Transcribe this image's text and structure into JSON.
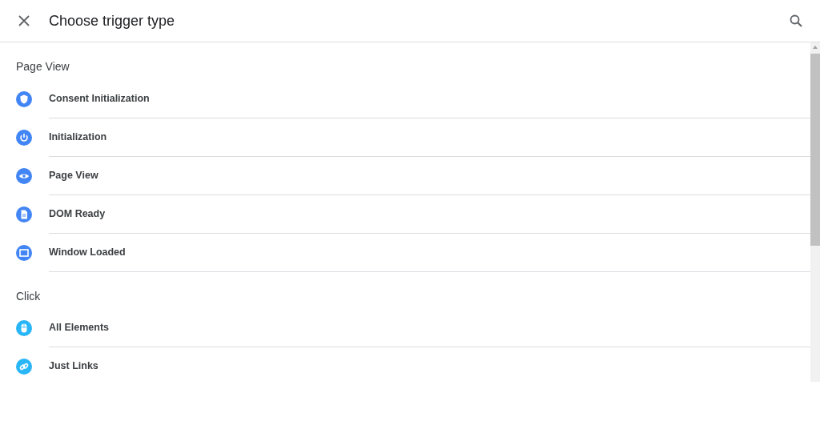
{
  "header": {
    "title": "Choose trigger type"
  },
  "sections": [
    {
      "heading": "Page View",
      "items": [
        {
          "label": "Consent Initialization",
          "kind": "shield",
          "color": "#4285f4"
        },
        {
          "label": "Initialization",
          "kind": "power",
          "color": "#4285f4"
        },
        {
          "label": "Page View",
          "kind": "eye",
          "color": "#4285f4"
        },
        {
          "label": "DOM Ready",
          "kind": "document",
          "color": "#4285f4"
        },
        {
          "label": "Window Loaded",
          "kind": "window",
          "color": "#4285f4"
        }
      ]
    },
    {
      "heading": "Click",
      "items": [
        {
          "label": "All Elements",
          "kind": "mouse",
          "color": "#29b6f6"
        },
        {
          "label": "Just Links",
          "kind": "link",
          "color": "#29b6f6"
        }
      ]
    }
  ]
}
